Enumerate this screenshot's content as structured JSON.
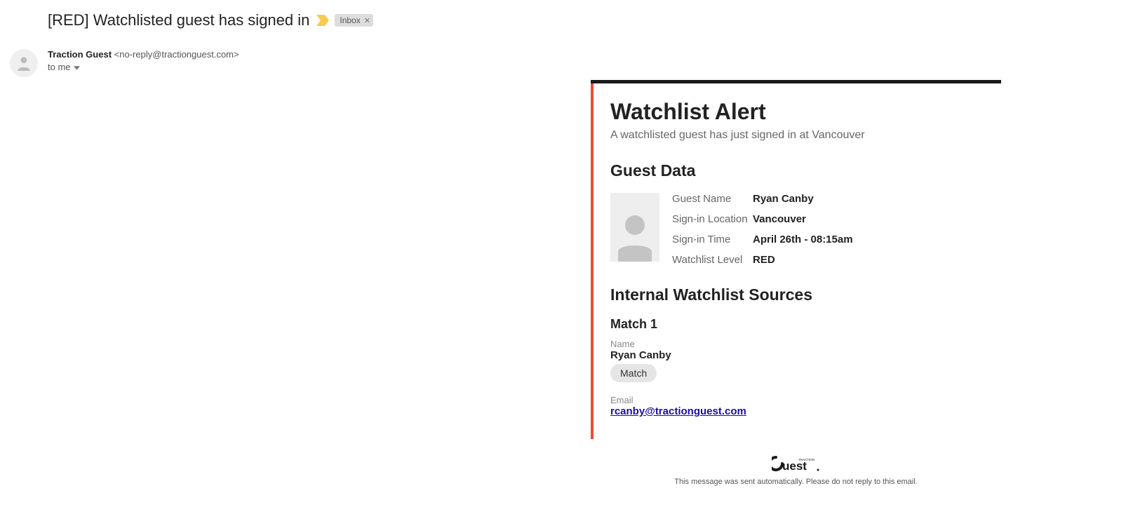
{
  "email": {
    "subject": "[RED] Watchlisted guest has signed in",
    "label": "Inbox",
    "sender_name": "Traction Guest",
    "sender_email": "<no-reply@tractionguest.com>",
    "to_line": "to me"
  },
  "alert": {
    "title": "Watchlist Alert",
    "subtitle": "A watchlisted guest has just signed in at Vancouver",
    "guest_data_title": "Guest Data",
    "fields": {
      "name_label": "Guest Name",
      "name_value": "Ryan Canby",
      "location_label": "Sign-in Location",
      "location_value": "Vancouver",
      "time_label": "Sign-in Time",
      "time_value": "April 26th - 08:15am",
      "level_label": "Watchlist Level",
      "level_value": "RED"
    },
    "sources_title": "Internal Watchlist Sources",
    "match": {
      "title": "Match 1",
      "name_label": "Name",
      "name_value": "Ryan Canby",
      "pill": "Match",
      "email_label": "Email",
      "email_value": "rcanby@tractionguest.com"
    }
  },
  "footer": {
    "logo_text": "Guest",
    "logo_small": "TRACTION",
    "disclaimer": "This message was sent automatically. Please do not reply to this email."
  }
}
